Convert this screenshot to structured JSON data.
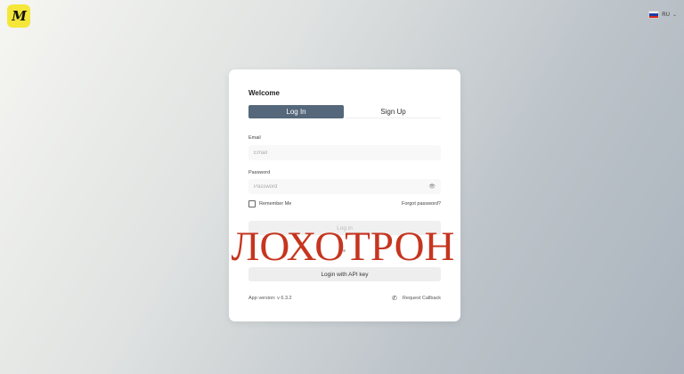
{
  "header": {
    "logo_text": "M",
    "language": "RU",
    "flag_colors": [
      "#ffffff",
      "#1c3fa8",
      "#d52b1e"
    ]
  },
  "card": {
    "title": "Welcome",
    "tabs": [
      {
        "label": "Log In",
        "active": true
      },
      {
        "label": "Sign Up",
        "active": false
      }
    ],
    "email": {
      "label": "Email",
      "placeholder": "Email",
      "value": ""
    },
    "password": {
      "label": "Password",
      "placeholder": "Password",
      "value": ""
    },
    "remember_label": "Remember Me",
    "forgot_label": "Forgot password?",
    "login_button": "Log in",
    "api_button": "Login with API key",
    "version": "App version: v 6.3.2",
    "callback_label": "Request Callback"
  },
  "overlay": {
    "text": "ЛОХОТРОН",
    "color": "#c6351f"
  },
  "colors": {
    "active_tab": "#55677a",
    "logo_bg": "#f5e63a"
  }
}
